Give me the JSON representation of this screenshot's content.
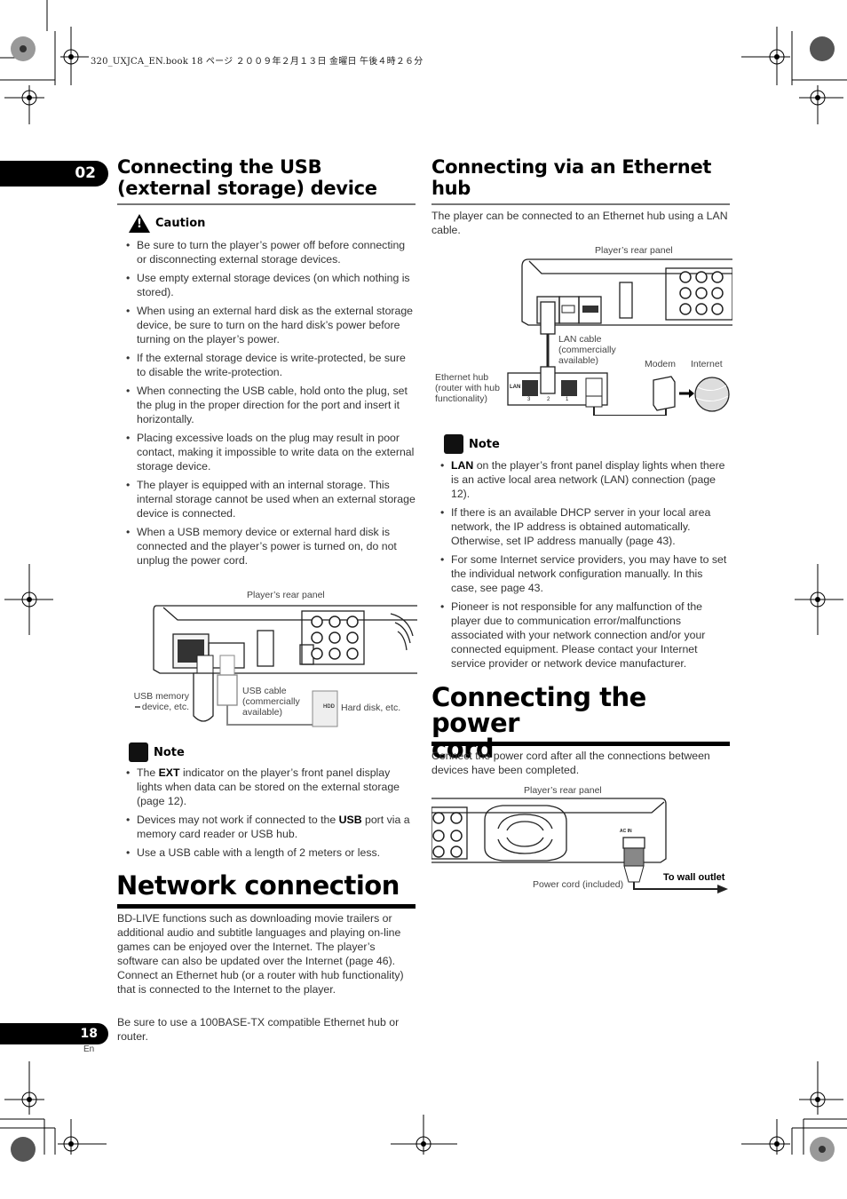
{
  "print_header": "320_UXJCA_EN.book  18 ページ  ２００９年２月１３日  金曜日  午後４時２６分",
  "chapter_number": "02",
  "page_number": "18",
  "page_language": "En",
  "usb_section": {
    "title_line1": "Connecting the USB",
    "title_line2": "(external storage) device",
    "caution_label": "Caution",
    "caution_items": [
      "Be sure to turn the player’s power off before connecting or disconnecting external storage devices.",
      "Use empty external storage devices (on which nothing is stored).",
      "When using an external hard disk as the external storage device, be sure to turn on the hard disk’s power before turning on the player’s power.",
      "If the external storage device is write-protected, be sure to disable the write-protection.",
      "When connecting the USB cable, hold onto the plug, set the plug in the proper direction for the port and insert it horizontally.",
      "Placing excessive loads on the plug may result in poor contact, making it impossible to write data on the external storage device.",
      "The player is equipped with an internal storage. This internal storage cannot be used when an external storage device is connected.",
      "When a USB memory device or external hard disk is connected and the player’s power is turned on, do not unplug the power cord."
    ],
    "diagram": {
      "rear_panel_label": "Player’s rear panel",
      "usb_memory_label_1": "USB memory",
      "usb_memory_label_2": "device, etc.",
      "usb_cable_label_1": "USB cable",
      "usb_cable_label_2": "(commercially",
      "usb_cable_label_3": "available)",
      "hdd_badge": "HDD",
      "hard_disk_label": "Hard disk, etc."
    },
    "note_label": "Note",
    "note_items": [
      {
        "pre": "The ",
        "bold": "EXT",
        "post": " indicator on the player’s front panel display lights when data can be stored on the external storage (page 12)."
      },
      {
        "pre": "Devices may not work if connected to the ",
        "bold": "USB",
        "post": " port via a memory card reader or USB hub."
      },
      {
        "pre": "Use a USB cable with a length of 2 meters or less.",
        "bold": "",
        "post": ""
      }
    ]
  },
  "network_section": {
    "title": "Network connection",
    "paragraph1": "BD-LIVE functions such as downloading movie trailers or additional audio and subtitle languages and playing on-line games can be enjoyed over the Internet. The player’s software can also be updated over the Internet (page 46). Connect an Ethernet hub (or a router with hub functionality) that is connected to the Internet to the player.",
    "paragraph2": "Be sure to use a 100BASE-TX compatible Ethernet hub or router."
  },
  "ethernet_section": {
    "title_line1": "Connecting via an Ethernet",
    "title_line2": "hub",
    "intro": "The player can be connected to an Ethernet hub using a LAN cable.",
    "diagram": {
      "rear_panel_label": "Player’s rear panel",
      "lan_cable_label_1": "LAN cable",
      "lan_cable_label_2": "(commercially",
      "lan_cable_label_3": "available)",
      "modem_label": "Modem",
      "internet_label": "Internet",
      "hub_label_1": "Ethernet hub",
      "hub_label_2": "(router with hub",
      "hub_label_3": "functionality)",
      "hub_lan_text": "LAN",
      "port_numbers": [
        "3",
        "2",
        "1"
      ]
    },
    "note_label": "Note",
    "note_items": [
      {
        "pre": "",
        "bold": "LAN",
        "post": " on the player’s front panel display lights when there is an active local area network (LAN) connection (page 12)."
      },
      {
        "pre": "If there is an available DHCP server in your local area network, the IP address is obtained automatically. Otherwise, set IP address manually (page 43).",
        "bold": "",
        "post": ""
      },
      {
        "pre": "For some Internet service providers, you may have to set the individual network configuration manually. In this case, see page 43.",
        "bold": "",
        "post": ""
      },
      {
        "pre": "Pioneer is not responsible for any malfunction of the player due to communication error/malfunctions associated with your network connection and/or your connected equipment. Please contact your Internet service provider or network device manufacturer.",
        "bold": "",
        "post": ""
      }
    ]
  },
  "power_section": {
    "title_line1": "Connecting the power",
    "title_line2": "cord",
    "intro": "Connect the power cord after all the connections between devices have been completed.",
    "diagram": {
      "rear_panel_label": "Player’s rear panel",
      "ac_in_label": "AC IN",
      "power_cord_label": "Power cord (included)",
      "wall_outlet_label": "To wall outlet"
    }
  }
}
